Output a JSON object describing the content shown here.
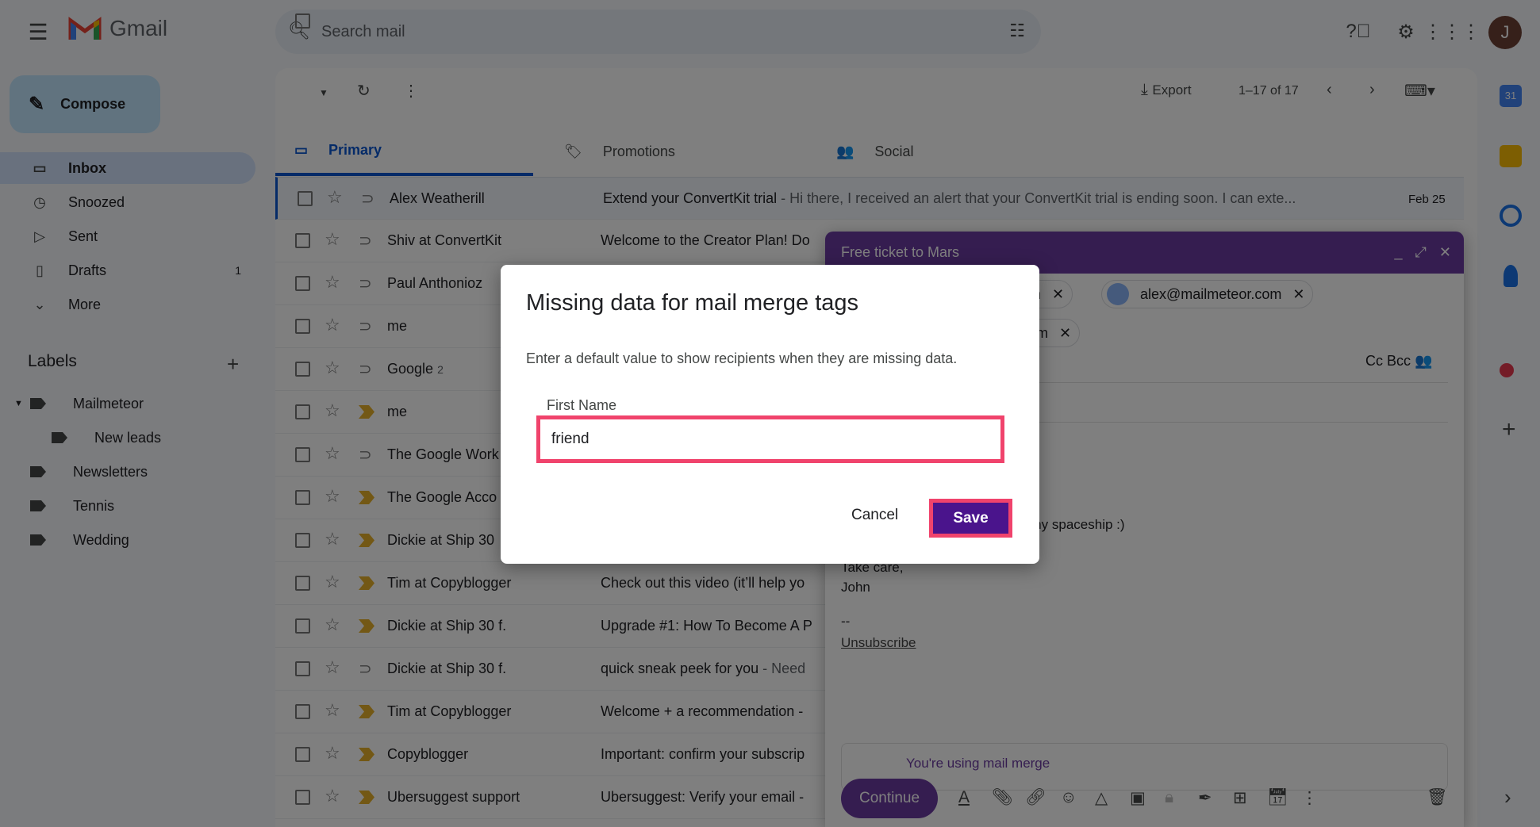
{
  "app": {
    "name": "Gmail"
  },
  "search": {
    "placeholder": "Search mail"
  },
  "avatar_letter": "J",
  "compose_label": "Compose",
  "nav": [
    {
      "label": "Inbox",
      "icon": "inbox-icon",
      "active": true
    },
    {
      "label": "Snoozed",
      "icon": "clock-icon"
    },
    {
      "label": "Sent",
      "icon": "send-icon"
    },
    {
      "label": "Drafts",
      "icon": "file-icon",
      "count": "1"
    },
    {
      "label": "More",
      "icon": "chevron-down-icon"
    }
  ],
  "labels": {
    "title": "Labels",
    "items": [
      {
        "label": "Mailmeteor",
        "expanded": true
      },
      {
        "label": "New leads",
        "nested": true
      },
      {
        "label": "Newsletters"
      },
      {
        "label": "Tennis"
      },
      {
        "label": "Wedding"
      }
    ]
  },
  "toolbar": {
    "export": "Export",
    "pagination": "1–17 of 17"
  },
  "tabs": [
    {
      "label": "Primary",
      "active": true
    },
    {
      "label": "Promotions"
    },
    {
      "label": "Social"
    }
  ],
  "emails": [
    {
      "sender": "Alex Weatherill",
      "subject": "Extend your ConvertKit trial",
      "snippet": " - Hi there, I received an alert that your ConvertKit trial is ending soon. I can exte...",
      "date": "Feb 25",
      "important": false
    },
    {
      "sender": "Shiv at ConvertKit",
      "subject": "Welcome to the Creator Plan! Do",
      "snippet": "",
      "date": "",
      "important": false
    },
    {
      "sender": "Paul Anthonioz",
      "subject": "",
      "snippet": "",
      "date": "",
      "important": false
    },
    {
      "sender": "me",
      "subject": "",
      "snippet": "",
      "date": "",
      "important": false
    },
    {
      "sender": "Google",
      "count": "2",
      "subject": "",
      "snippet": "",
      "date": "",
      "important": false
    },
    {
      "sender": "me",
      "subject": "",
      "snippet": "",
      "date": "",
      "important": true
    },
    {
      "sender": "The Google Work",
      "subject": "",
      "snippet": "",
      "date": "",
      "important": false
    },
    {
      "sender": "The Google Acco",
      "subject": "",
      "snippet": "",
      "date": "",
      "important": true
    },
    {
      "sender": "Dickie at Ship 30",
      "subject": "",
      "snippet": "",
      "date": "",
      "important": true
    },
    {
      "sender": "Tim at Copyblogger",
      "subject": "Check out this video (it’ll help yo",
      "snippet": "",
      "date": "",
      "important": true
    },
    {
      "sender": "Dickie at Ship 30 f.",
      "subject": "Upgrade #1: How To Become A P",
      "snippet": "",
      "date": "",
      "important": true
    },
    {
      "sender": "Dickie at Ship 30 f.",
      "subject": "quick sneak peek for you",
      "snippet": " - Need",
      "date": "",
      "important": false
    },
    {
      "sender": "Tim at Copyblogger",
      "subject": "Welcome + a recommendation -",
      "snippet": "",
      "date": "",
      "important": true
    },
    {
      "sender": "Copyblogger",
      "subject": "Important: confirm your subscrip",
      "snippet": "",
      "date": "",
      "important": true
    },
    {
      "sender": "Ubersuggest support",
      "subject": "Ubersuggest: Verify your email -",
      "snippet": "",
      "date": "",
      "important": true
    }
  ],
  "compose": {
    "title": "Free ticket to Mars",
    "chip1": "om",
    "chip2": "alex@mailmeteor.com",
    "chip3": "com",
    "cc_bcc": "Cc Bcc",
    "body_line": "l my spaceship :)",
    "signoff": "Take care,",
    "name": "John",
    "sep": "--",
    "unsubscribe": "Unsubscribe",
    "merge_notice": "You're using mail merge",
    "continue": "Continue"
  },
  "dialog": {
    "title": "Missing data for mail merge tags",
    "subtitle": "Enter a default value to show recipients when they are missing data.",
    "field_label": "First Name",
    "field_value": "friend",
    "cancel": "Cancel",
    "save": "Save"
  },
  "colors": {
    "accent": "#0b57d0",
    "compose_header": "#6b3aa1",
    "save_button": "#4a148c",
    "highlight_border": "#f0436c",
    "important": "#e6b12a"
  }
}
